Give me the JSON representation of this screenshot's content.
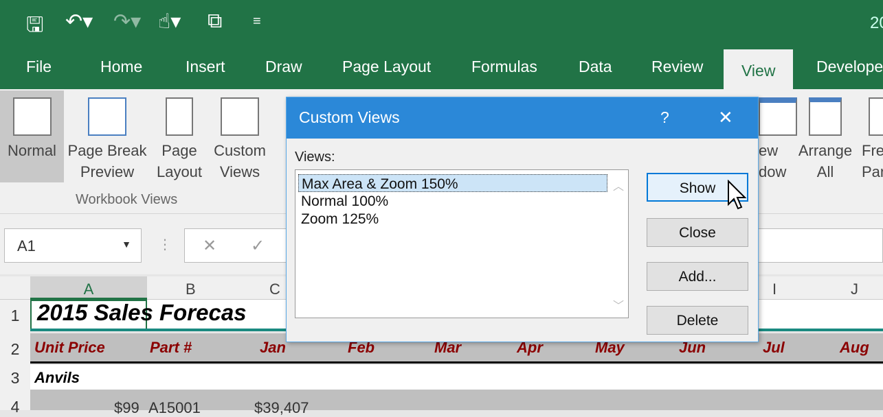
{
  "titlebar": {
    "title_partial": "20"
  },
  "tabs": [
    "File",
    "Home",
    "Insert",
    "Draw",
    "Page Layout",
    "Formulas",
    "Data",
    "Review",
    "View",
    "Develope"
  ],
  "active_tab": "View",
  "ribbon": {
    "workbook_views": [
      "Normal",
      "Page Break\nPreview",
      "Page\nLayout",
      "Custom\nViews"
    ],
    "group_label": "Workbook Views",
    "window_partial": [
      "ew\ndow",
      "Arrange\nAll",
      "Fre\nPan"
    ]
  },
  "formula_bar": {
    "name_box": "A1",
    "cancel": "✕",
    "enter": "✓"
  },
  "columns": [
    "A",
    "B",
    "C",
    "I",
    "J"
  ],
  "rows": [
    "1",
    "2",
    "3",
    "4"
  ],
  "sheet": {
    "title": "2015 Sales Forecas",
    "headers": [
      "Unit Price",
      "Part #",
      "Jan",
      "Feb",
      "Mar",
      "Apr",
      "May",
      "Jun",
      "Jul",
      "Aug"
    ],
    "row3": "Anvils",
    "row4": [
      "$99",
      "A15001",
      "$39,407"
    ]
  },
  "dialog": {
    "title": "Custom Views",
    "help": "?",
    "close": "✕",
    "views_label": "Views:",
    "views": [
      "Max Area & Zoom 150%",
      "Normal 100%",
      "Zoom 125%"
    ],
    "selected": 0,
    "buttons": [
      "Show",
      "Close",
      "Add...",
      "Delete"
    ]
  },
  "colors": {
    "excel_green": "#217346",
    "dialog_blue": "#2b88d8",
    "header_red": "#8b0000"
  }
}
